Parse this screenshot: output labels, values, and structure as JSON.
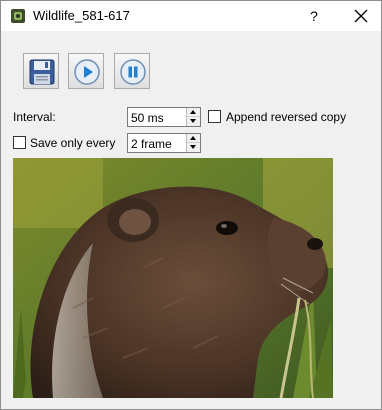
{
  "window": {
    "title": "Wildlife_581-617",
    "help_label": "?",
    "close_icon": "close-icon",
    "app_icon": "wildlife-app-icon"
  },
  "toolbar": {
    "save_icon": "floppy-disk-icon",
    "play_icon": "play-icon",
    "pause_icon": "pause-icon"
  },
  "options": {
    "interval_label": "Interval:",
    "interval_value": "50 ms",
    "append_reversed_label": "Append reversed copy",
    "append_reversed_checked": false,
    "save_only_every_label": "Save only every",
    "save_only_every_checked": false,
    "frame_value": "2 frame"
  },
  "preview": {
    "subject": "marmot-head-photo"
  },
  "colors": {
    "play_blue": "#1f7fd4",
    "button_circle": "#e8eef6",
    "floppy_blue": "#3a5f9c"
  }
}
